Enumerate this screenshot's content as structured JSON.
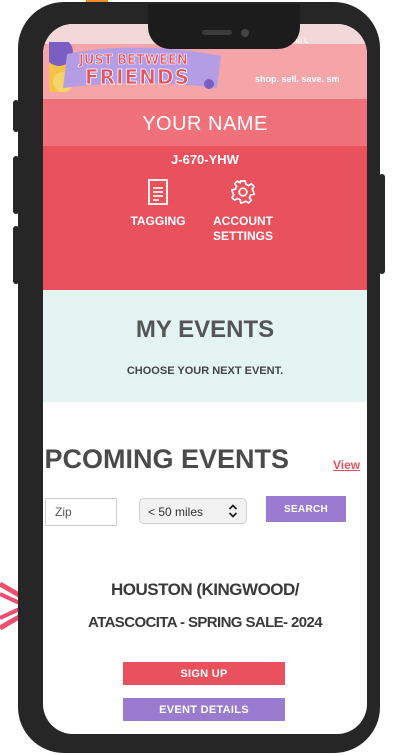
{
  "header": {
    "logo_line1": "JUST BETWEEN",
    "logo_line2": "FRIENDS",
    "tagline": "shop. sell. save. sm",
    "top_links": "ho          L"
  },
  "account": {
    "name": "YOUR NAME",
    "code": "J-670-YHW",
    "menu": [
      {
        "label_line1": "TAGGING",
        "label_line2": "",
        "icon": "document-icon"
      },
      {
        "label_line1": "ACCOUNT",
        "label_line2": "SETTINGS",
        "icon": "gear-icon"
      }
    ]
  },
  "my_events": {
    "title": "MY EVENTS",
    "subtitle": "CHOOSE YOUR NEXT EVENT."
  },
  "upcoming": {
    "title": "UPCOMING EVENTS",
    "view_link": "View"
  },
  "search": {
    "zip_placeholder": "Zip",
    "distance_selected": "< 50 miles",
    "button": "SEARCH"
  },
  "event": {
    "title_line1": "HOUSTON (KINGWOOD/",
    "title_line2": "ATASCOCITA - SPRING SALE- 2024",
    "signup": "SIGN UP",
    "details": "EVENT DETAILS"
  },
  "colors": {
    "accent_red": "#e9525d",
    "accent_pink": "#f0717a",
    "accent_purple": "#9b7bcf",
    "events_bg": "#e3f4f3"
  }
}
